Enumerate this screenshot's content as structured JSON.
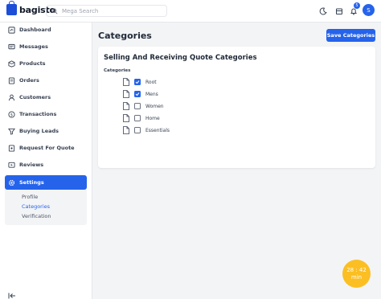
{
  "header": {
    "brand": "bagisto",
    "search_placeholder": "Mega Search",
    "notification_count": "5",
    "avatar_initial": "S"
  },
  "sidebar": {
    "items": [
      {
        "label": "Dashboard",
        "icon": "dashboard-icon"
      },
      {
        "label": "Messages",
        "icon": "messages-icon"
      },
      {
        "label": "Products",
        "icon": "products-icon"
      },
      {
        "label": "Orders",
        "icon": "orders-icon"
      },
      {
        "label": "Customers",
        "icon": "customers-icon"
      },
      {
        "label": "Transactions",
        "icon": "transactions-icon"
      },
      {
        "label": "Buying Leads",
        "icon": "buying-leads-icon"
      },
      {
        "label": "Request For Quote",
        "icon": "request-quote-icon"
      },
      {
        "label": "Reviews",
        "icon": "reviews-icon"
      },
      {
        "label": "Settings",
        "icon": "settings-icon",
        "active": true
      }
    ],
    "submenu": [
      {
        "label": "Profile"
      },
      {
        "label": "Categories",
        "active": true
      },
      {
        "label": "Verification"
      }
    ]
  },
  "main": {
    "title": "Categories",
    "save_label": "Save Categories",
    "card_title": "Selling And Receiving Quote Categories",
    "field_label": "Categories",
    "categories": [
      {
        "label": "Root",
        "checked": true
      },
      {
        "label": "Mens",
        "checked": true
      },
      {
        "label": "Women",
        "checked": false
      },
      {
        "label": "Home",
        "checked": false
      },
      {
        "label": "Essentials",
        "checked": false
      }
    ]
  },
  "timer": {
    "time": "28 : 42",
    "unit": "min"
  },
  "colors": {
    "accent": "#2563eb",
    "timer": "#fbbf24",
    "background": "#f3f4f6"
  }
}
